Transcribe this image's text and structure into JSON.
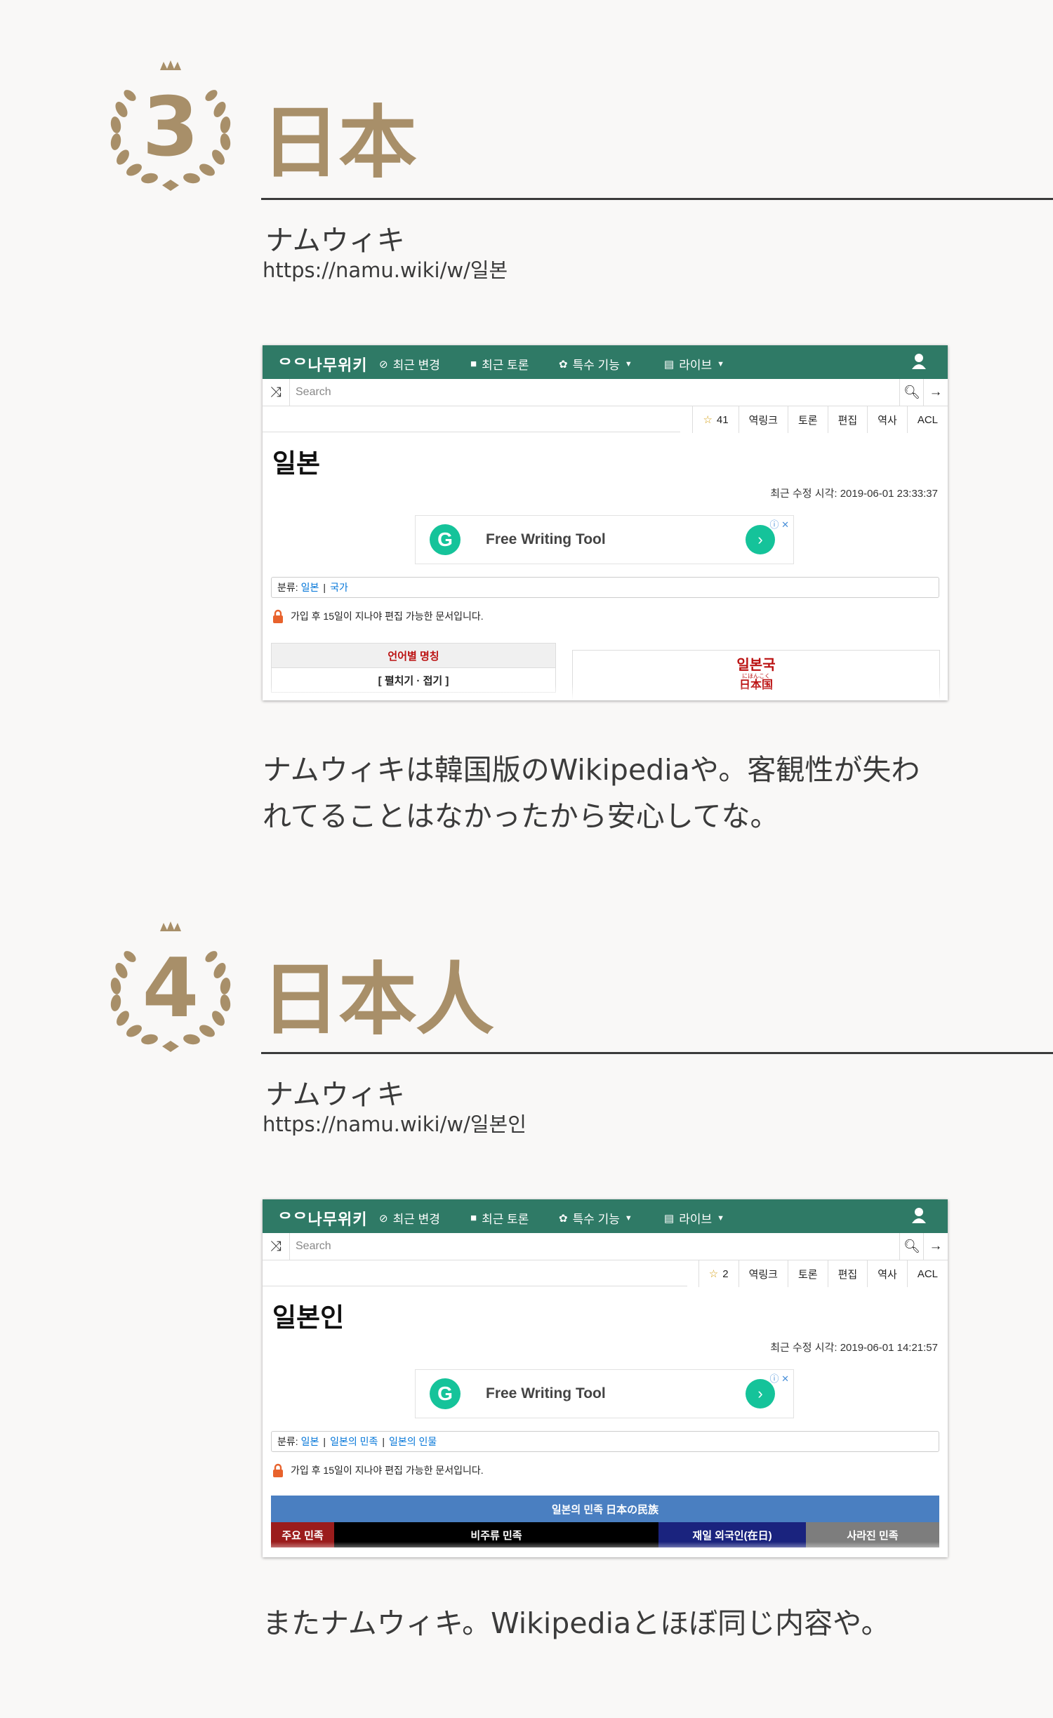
{
  "entries": [
    {
      "rank": "3",
      "title": "日本",
      "site": "ナムウィキ",
      "url": "https://namu.wiki/w/일본",
      "caption_line1": "ナムウィキは韓国版のWikipediaや。客観性が失わ",
      "caption_line2": "れてることはなかったから安心してな。",
      "shot": {
        "logo": "ᄋᄋ나무위키",
        "nav": [
          "최근 변경",
          "최근 토론",
          "특수 기능",
          "라이브"
        ],
        "search_placeholder": "Search",
        "star_count": "41",
        "tabs": [
          "역링크",
          "토론",
          "편집",
          "역사",
          "ACL"
        ],
        "doc_title": "일본",
        "modified": "최근 수정 시각: 2019-06-01 23:33:37",
        "ad_text": "Free Writing Tool",
        "category_label": "분류:",
        "categories": [
          "일본",
          "국가"
        ],
        "notice": "가입 후 15일이 지나야 편집 가능한 문서입니다.",
        "names_head": "언어별 명칭",
        "names_toggle": "[ 펼치기 · 접기 ]",
        "country_name": "일본국",
        "country_ruby": "にほんこく",
        "country_kanji": "日本国"
      }
    },
    {
      "rank": "4",
      "title": "日本人",
      "site": "ナムウィキ",
      "url": "https://namu.wiki/w/일본인",
      "caption_line1": "またナムウィキ。Wikipediaとほぼ同じ内容や。",
      "shot": {
        "logo": "ᄋᄋ나무위키",
        "nav": [
          "최근 변경",
          "최근 토론",
          "특수 기능",
          "라이브"
        ],
        "search_placeholder": "Search",
        "star_count": "2",
        "tabs": [
          "역링크",
          "토론",
          "편집",
          "역사",
          "ACL"
        ],
        "doc_title": "일본인",
        "modified": "최근 수정 시각: 2019-06-01 14:21:57",
        "ad_text": "Free Writing Tool",
        "category_label": "분류:",
        "categories": [
          "일본",
          "일본의 민족",
          "일본의 인물"
        ],
        "notice": "가입 후 15일이 지나야 편집 가능한 문서입니다.",
        "ethnic_head": "일본의 민족 日本の民族",
        "ethnic_cells": [
          "주요 민족",
          "비주류 민족",
          "재일 외국인(在日)",
          "사라진 민족"
        ]
      }
    }
  ],
  "colors": {
    "gold": "#a88f69",
    "navbar": "#2f7a66",
    "ethnic_head": "#4a7fc1",
    "ethnic_cells": [
      "#9b1c1c",
      "#000000",
      "#1a237e",
      "#7d7d7d"
    ]
  }
}
